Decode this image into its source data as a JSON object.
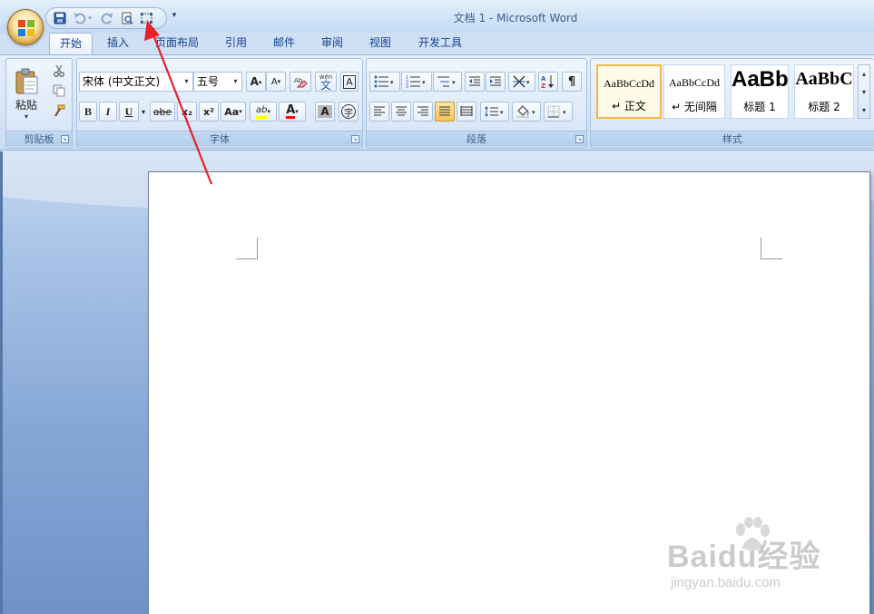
{
  "window": {
    "title": "文档 1 - Microsoft Word"
  },
  "quick_access": {
    "items": [
      "save-icon",
      "undo-icon",
      "redo-icon",
      "print-preview-icon",
      "select-objects-icon"
    ],
    "customize_glyph": "▾"
  },
  "tabs": [
    {
      "label": "开始",
      "active": true
    },
    {
      "label": "插入"
    },
    {
      "label": "页面布局"
    },
    {
      "label": "引用"
    },
    {
      "label": "邮件"
    },
    {
      "label": "审阅"
    },
    {
      "label": "视图"
    },
    {
      "label": "开发工具"
    }
  ],
  "clipboard": {
    "label": "剪贴板",
    "paste_label": "粘贴"
  },
  "font": {
    "label": "字体",
    "font_name": "宋体 (中文正文)",
    "font_size": "五号",
    "bold": "B",
    "italic": "I",
    "underline": "U",
    "strike": "abe",
    "subscript": "x₂",
    "superscript": "x²",
    "change_case": "Aa",
    "grow": "A",
    "shrink": "A",
    "char_border": "A",
    "char_shading": "A",
    "phonetic": "wén",
    "phonetic_char": "文",
    "enclose": "字",
    "highlight": "ab",
    "font_color": "A"
  },
  "paragraph": {
    "label": "段落"
  },
  "styles": {
    "label": "样式",
    "items": [
      {
        "sample": "AaBbCcDd",
        "name": "↵ 正文",
        "selected": true
      },
      {
        "sample": "AaBbCcDd",
        "name": "↵ 无间隔"
      },
      {
        "sample": "AaBb",
        "name": "标题 1"
      },
      {
        "sample": "AaBbC",
        "name": "标题 2"
      }
    ]
  },
  "watermark": {
    "brand": "Baidu经验",
    "url": "jingyan.baidu.com"
  },
  "colors": {
    "accent": "#15428b",
    "ribbon": "#dbe8f8",
    "highlight_yellow": "#ffff00",
    "font_red": "#ff0000",
    "arrow_red": "#e8202a"
  }
}
